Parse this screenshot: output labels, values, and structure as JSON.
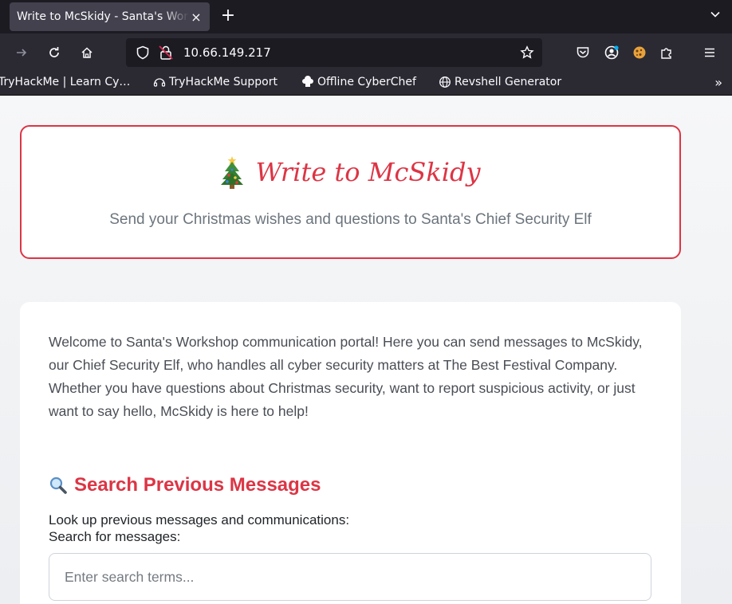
{
  "browser": {
    "tab_title": "Write to McSkidy - Santa's Workshop",
    "tab_close": "×",
    "new_tab": "+",
    "url": "10.66.149.217",
    "bookmarks": [
      {
        "label": "TryHackMe | Learn Cy…",
        "icon": "tryhackme-icon"
      },
      {
        "label": "TryHackMe Support",
        "icon": "support-icon"
      },
      {
        "label": "Offline CyberChef",
        "icon": "chef-hat-icon"
      },
      {
        "label": "Revshell Generator",
        "icon": "globe-icon"
      }
    ],
    "bookmarks_more": "»"
  },
  "header": {
    "icon": "christmas-tree-icon",
    "title": "Write to McSkidy",
    "subtitle": "Send your Christmas wishes and questions to Santa's Chief Security Elf"
  },
  "main": {
    "intro_line1": "Welcome to Santa's Workshop communication portal! Here you can send messages to McSkidy, our Chief Security Elf, who handles all cyber security matters at The Best Festival Company.",
    "intro_line2": "Whether you have questions about Christmas security, want to report suspicious activity, or just want to say hello, McSkidy is here to help!",
    "search_heading": "Search Previous Messages",
    "search_description": "Look up previous messages and communications:",
    "search_label": "Search for messages:",
    "search_placeholder": "Enter search terms...",
    "search_value": ""
  },
  "colors": {
    "accent": "#dc3545",
    "muted_text": "#6c757d",
    "chrome_dark": "#1c1b22",
    "chrome": "#2b2a33"
  }
}
